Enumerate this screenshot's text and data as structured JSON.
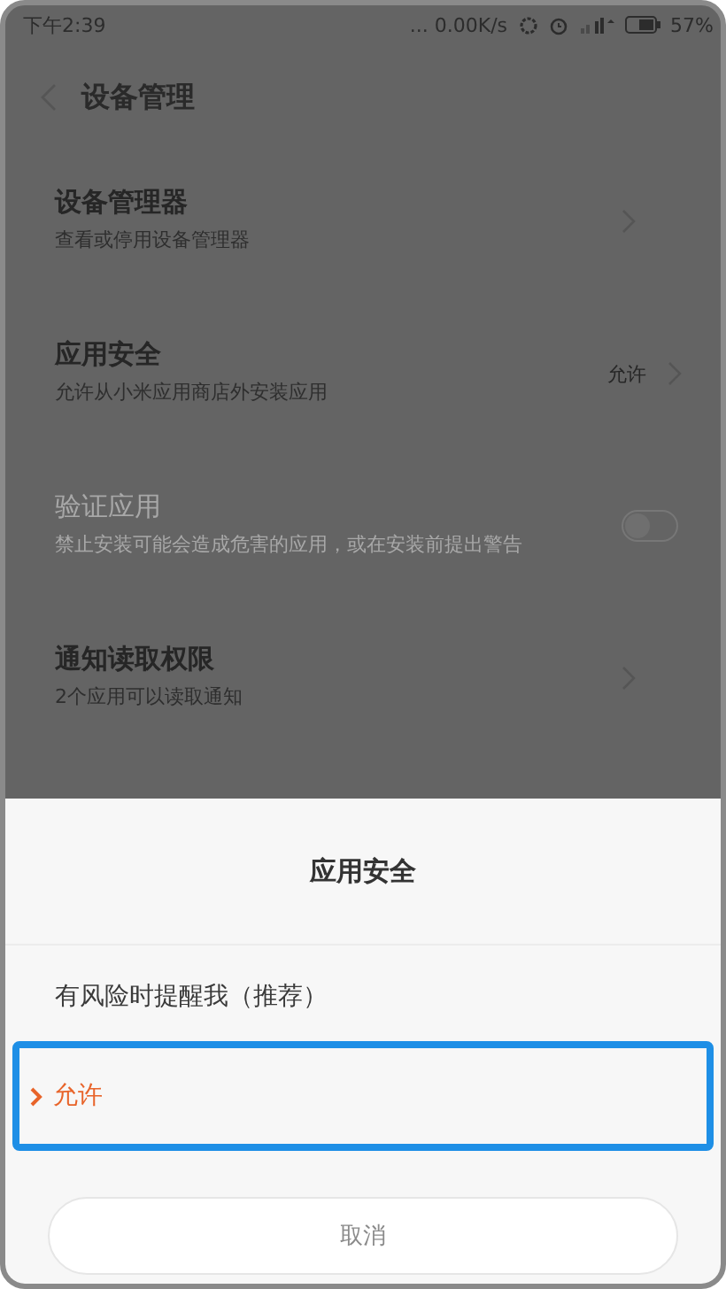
{
  "status_bar": {
    "time": "下午2:39",
    "network_speed": "... 0.00K/s",
    "battery": "57%"
  },
  "header": {
    "title": "设备管理"
  },
  "settings": [
    {
      "kind": "link",
      "title": "设备管理器",
      "subtitle": "查看或停用设备管理器",
      "disabled": false
    },
    {
      "kind": "link",
      "title": "应用安全",
      "subtitle": "允许从小米应用商店外安装应用",
      "value": "允许",
      "disabled": false
    },
    {
      "kind": "toggle",
      "title": "验证应用",
      "subtitle": "禁止安装可能会造成危害的应用，或在安装前提出警告",
      "disabled": true,
      "on": false
    },
    {
      "kind": "link",
      "title": "通知读取权限",
      "subtitle": "2个应用可以读取通知",
      "disabled": false
    }
  ],
  "dialog": {
    "title": "应用安全",
    "options": [
      {
        "label": "有风险时提醒我（推荐）",
        "selected": false
      },
      {
        "label": "允许",
        "selected": true
      }
    ],
    "cancel": "取消"
  }
}
